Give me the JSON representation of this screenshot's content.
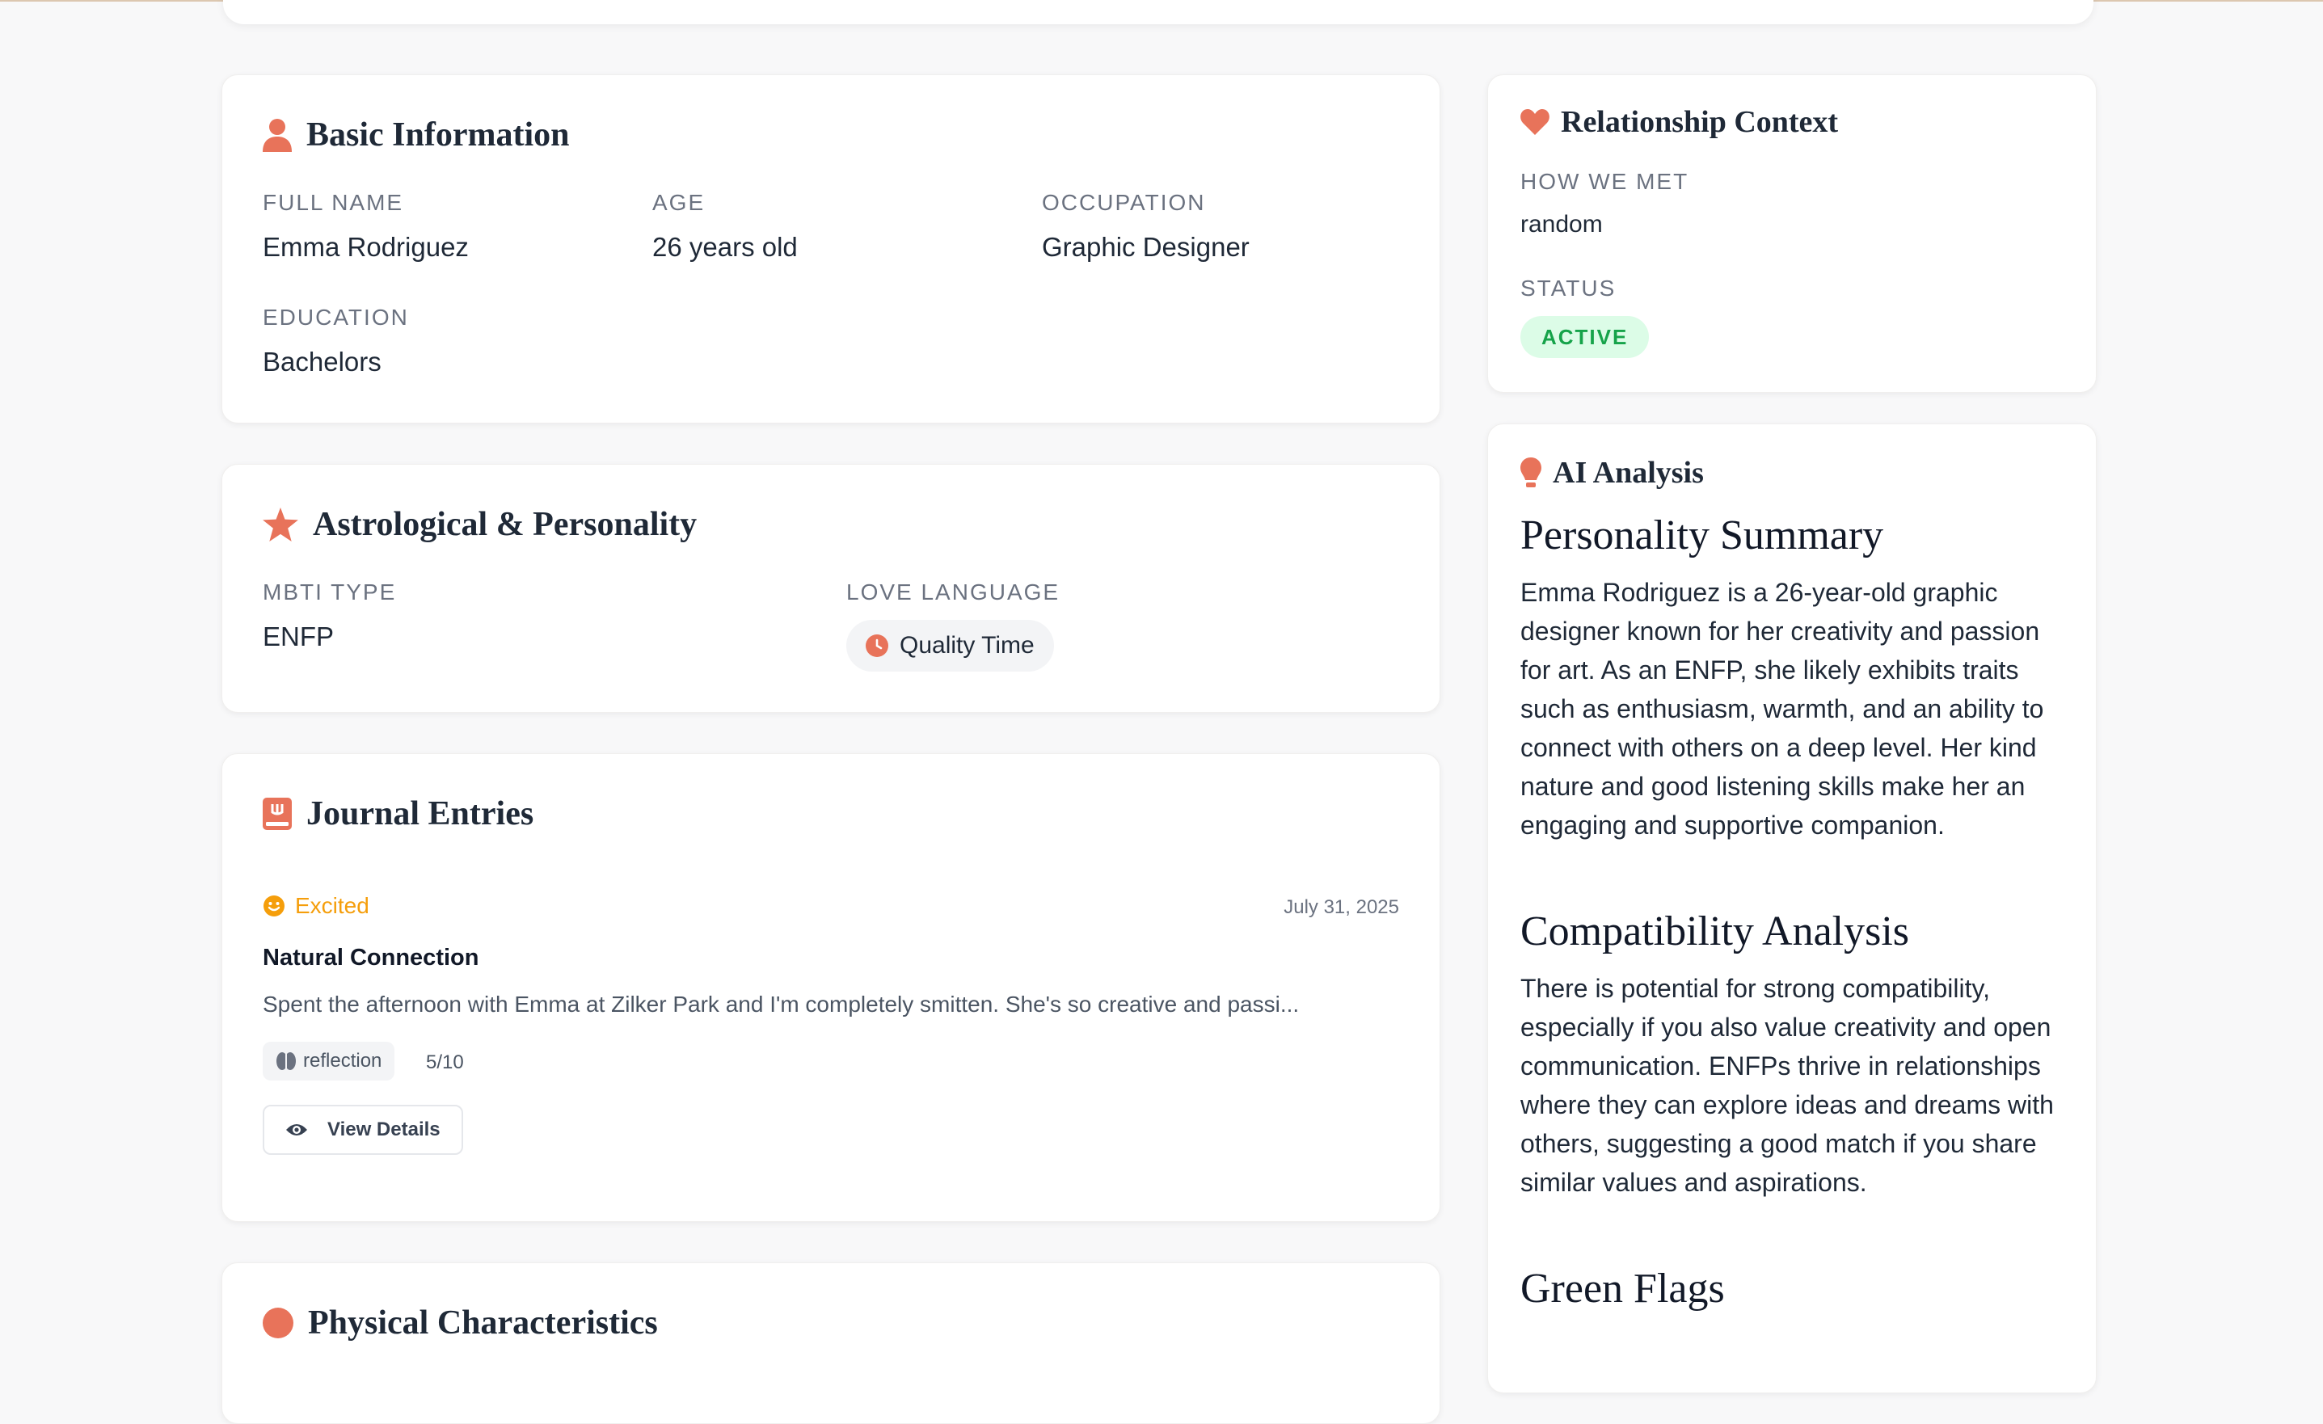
{
  "basic_info": {
    "title": "Basic Information",
    "fields": [
      {
        "label": "FULL NAME",
        "value": "Emma Rodriguez"
      },
      {
        "label": "AGE",
        "value": "26 years old"
      },
      {
        "label": "OCCUPATION",
        "value": "Graphic Designer"
      },
      {
        "label": "EDUCATION",
        "value": "Bachelors"
      }
    ]
  },
  "astro": {
    "title": "Astrological & Personality",
    "mbti_label": "MBTI TYPE",
    "mbti_value": "ENFP",
    "love_label": "LOVE LANGUAGE",
    "love_value": "Quality Time"
  },
  "journal": {
    "title": "Journal Entries",
    "entry": {
      "mood": "Excited",
      "date": "July 31, 2025",
      "title": "Natural Connection",
      "excerpt": "Spent the afternoon with Emma at Zilker Park and I'm completely smitten. She's so creative and passi...",
      "tag": "reflection",
      "score": "5/10",
      "view_label": "View Details"
    }
  },
  "next_card": {
    "title": "Physical Characteristics"
  },
  "relationship": {
    "title": "Relationship Context",
    "how_label": "HOW WE MET",
    "how_value": "random",
    "status_label": "STATUS",
    "status_value": "ACTIVE"
  },
  "ai": {
    "title": "AI Analysis",
    "personality_heading": "Personality Summary",
    "personality_text": "Emma Rodriguez is a 26-year-old graphic designer known for her creativity and passion for art. As an ENFP, she likely exhibits traits such as enthusiasm, warmth, and an ability to connect with others on a deep level. Her kind nature and good listening skills make her an engaging and supportive companion.",
    "compat_heading": "Compatibility Analysis",
    "compat_text": "There is potential for strong compatibility, especially if you also value creativity and open communication. ENFPs thrive in relationships where they can explore ideas and dreams with others, suggesting a good match if you share similar values and aspirations.",
    "flags_heading": "Green Flags"
  },
  "colors": {
    "accent": "#e8735a",
    "mood": "#f59e0b",
    "active_bg": "#dcfce7",
    "active_text": "#16a34a"
  }
}
